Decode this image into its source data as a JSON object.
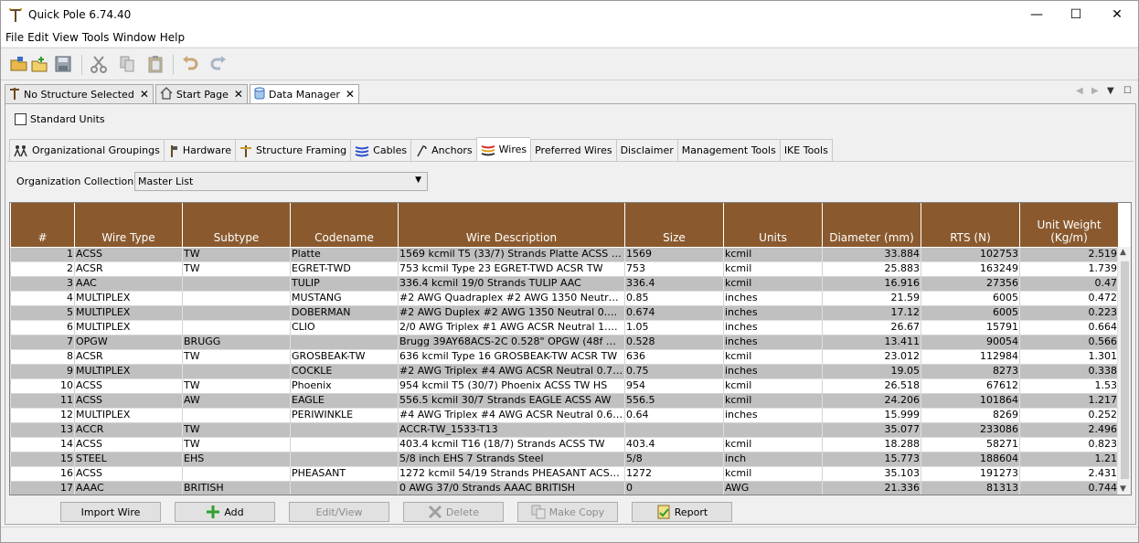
{
  "window": {
    "title": "Quick Pole 6.74.40",
    "minimize": "—",
    "maximize": "☐",
    "close": "✕"
  },
  "menu": [
    "File",
    "Edit",
    "View",
    "Tools",
    "Window",
    "Help"
  ],
  "toolbar_icons": [
    "open-folder-icon",
    "new-file-icon",
    "save-icon",
    "cut-icon",
    "copy-icon",
    "paste-icon",
    "undo-icon",
    "redo-icon"
  ],
  "doc_tabs": [
    {
      "label": "No Structure Selected",
      "active": false
    },
    {
      "label": "Start Page",
      "active": false
    },
    {
      "label": "Data Manager",
      "active": true
    }
  ],
  "standard_units_label": "Standard Units",
  "sub_tabs": [
    {
      "label": "Organizational Groupings",
      "icon": "org-groupings-icon"
    },
    {
      "label": "Hardware",
      "icon": "hardware-icon"
    },
    {
      "label": "Structure Framing",
      "icon": "framing-icon"
    },
    {
      "label": "Cables",
      "icon": "cables-icon"
    },
    {
      "label": "Anchors",
      "icon": "anchors-icon"
    },
    {
      "label": "Wires",
      "icon": "wires-icon",
      "active": true
    },
    {
      "label": "Preferred Wires"
    },
    {
      "label": "Disclaimer"
    },
    {
      "label": "Management Tools"
    },
    {
      "label": "IKE Tools"
    }
  ],
  "org_collection": {
    "label": "Organization Collection",
    "value": "Master List"
  },
  "table": {
    "headers": [
      "#",
      "Wire Type",
      "Subtype",
      "Codename",
      "Wire Description",
      "Size",
      "Units",
      "Diameter  (mm)",
      "RTS (N)",
      "Unit Weight (Kg/m)"
    ],
    "rows": [
      [
        "1",
        "ACSS",
        "TW",
        "Platte",
        "1569 kcmil T5 (33/7) Strands Platte ACSS TW",
        "1569",
        "kcmil",
        "33.884",
        "102753",
        "2.519"
      ],
      [
        "2",
        "ACSR",
        "TW",
        "EGRET-TWD",
        "753 kcmil Type 23 EGRET-TWD ACSR TW",
        "753",
        "kcmil",
        "25.883",
        "163249",
        "1.739"
      ],
      [
        "3",
        "AAC",
        "",
        "TULIP",
        "336.4 kcmil 19/0 Strands TULIP AAC",
        "336.4",
        "kcmil",
        "16.916",
        "27356",
        "0.47"
      ],
      [
        "4",
        "MULTIPLEX",
        "",
        "MUSTANG",
        "#2 AWG Quadraplex #2 AWG 1350 Neutral 0.85 inches",
        "0.85",
        "inches",
        "21.59",
        "6005",
        "0.472"
      ],
      [
        "5",
        "MULTIPLEX",
        "",
        "DOBERMAN",
        "#2 AWG Duplex #2 AWG 1350 Neutral 0.674 inches",
        "0.674",
        "inches",
        "17.12",
        "6005",
        "0.223"
      ],
      [
        "6",
        "MULTIPLEX",
        "",
        "CLIO",
        "2/0 AWG Triplex #1 AWG ACSR Neutral 1.05 inches",
        "1.05",
        "inches",
        "26.67",
        "15791",
        "0.664"
      ],
      [
        "7",
        "OPGW",
        "BRUGG",
        "",
        "Brugg 39AY68ACS-2C 0.528\" OPGW (48f max 64f)",
        "0.528",
        "inches",
        "13.411",
        "90054",
        "0.566"
      ],
      [
        "8",
        "ACSR",
        "TW",
        "GROSBEAK-TW",
        "636 kcmil Type 16 GROSBEAK-TW ACSR TW",
        "636",
        "kcmil",
        "23.012",
        "112984",
        "1.301"
      ],
      [
        "9",
        "MULTIPLEX",
        "",
        "COCKLE",
        "#2 AWG Triplex #4 AWG ACSR Neutral 0.75 inches",
        "0.75",
        "inches",
        "19.05",
        "8273",
        "0.338"
      ],
      [
        "10",
        "ACSS",
        "TW",
        "Phoenix",
        "954 kcmil T5 (30/7) Phoenix ACSS TW HS",
        "954",
        "kcmil",
        "26.518",
        "67612",
        "1.53"
      ],
      [
        "11",
        "ACSS",
        "AW",
        "EAGLE",
        "556.5 kcmil 30/7 Strands EAGLE ACSS AW",
        "556.5",
        "kcmil",
        "24.206",
        "101864",
        "1.217"
      ],
      [
        "12",
        "MULTIPLEX",
        "",
        "PERIWINKLE",
        "#4 AWG Triplex #4 AWG ACSR Neutral 0.64 inches",
        "0.64",
        "inches",
        "15.999",
        "8269",
        "0.252"
      ],
      [
        "13",
        "ACCR",
        "TW",
        "",
        "ACCR-TW_1533-T13",
        "",
        "",
        "35.077",
        "233086",
        "2.496"
      ],
      [
        "14",
        "ACSS",
        "TW",
        "",
        "403.4 kcmil T16 (18/7) Strands  ACSS TW",
        "403.4",
        "kcmil",
        "18.288",
        "58271",
        "0.823"
      ],
      [
        "15",
        "STEEL",
        "EHS",
        "",
        "5/8 inch EHS 7 Strands  Steel",
        "5/8",
        "inch",
        "15.773",
        "188604",
        "1.21"
      ],
      [
        "16",
        "ACSS",
        "",
        "PHEASANT",
        "1272 kcmil 54/19 Strands PHEASANT ACSS HS285",
        "1272",
        "kcmil",
        "35.103",
        "191273",
        "2.431"
      ],
      [
        "17",
        "AAAC",
        "BRITISH",
        "",
        "0 AWG 37/0 Strands  AAAC BRITISH",
        "0",
        "AWG",
        "21.336",
        "81313",
        "0.744"
      ]
    ]
  },
  "buttons": [
    {
      "label": "Import Wire",
      "enabled": true
    },
    {
      "label": "Add",
      "enabled": true,
      "icon": "plus-icon"
    },
    {
      "label": "Edit/View",
      "enabled": false
    },
    {
      "label": "Delete",
      "enabled": false,
      "icon": "x-icon"
    },
    {
      "label": "Make Copy",
      "enabled": false,
      "icon": "copy-icon"
    },
    {
      "label": "Report",
      "enabled": true,
      "icon": "report-icon"
    }
  ]
}
